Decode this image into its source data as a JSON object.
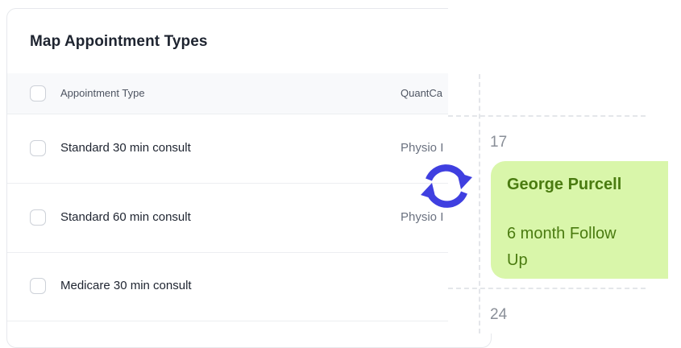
{
  "card": {
    "title": "Map Appointment Types",
    "columns": [
      "Appointment Type",
      "QuantCa"
    ],
    "rows": [
      {
        "type": "Standard 30 min consult",
        "quantcal": "Physio I"
      },
      {
        "type": "Standard 60 min consult",
        "quantcal": "Physio I"
      },
      {
        "type": "Medicare 30 min consult",
        "quantcal": ""
      }
    ]
  },
  "calendar": {
    "day_labels": [
      "17",
      "24"
    ],
    "event": {
      "name": "George Purcell",
      "description": "6 month Follow Up"
    }
  },
  "icons": {
    "sync": "sync-arrows-icon"
  },
  "colors": {
    "accent": "#3f3fe0",
    "event_bg": "#d9f6aa",
    "event_text": "#4a7b10"
  }
}
